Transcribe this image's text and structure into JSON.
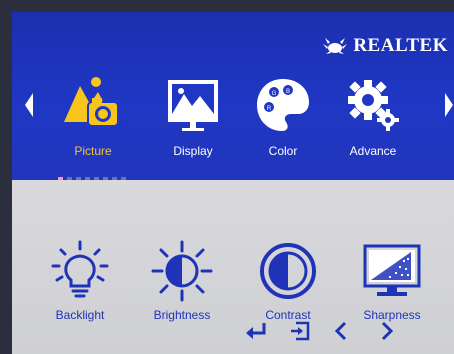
{
  "brand": {
    "name": "REALTEK"
  },
  "colors": {
    "active": "#f7c51c",
    "panel_blue": "#1f37c4",
    "label_blue": "#1f33b8",
    "page_dot": "#ff8fd0"
  },
  "tabs": [
    {
      "label": "Picture",
      "icon": "picture-icon",
      "active": true
    },
    {
      "label": "Display",
      "icon": "display-icon",
      "active": false
    },
    {
      "label": "Color",
      "icon": "color-palette-icon",
      "active": false
    },
    {
      "label": "Advance",
      "icon": "advance-gears-icon",
      "active": false
    }
  ],
  "page_indicator": {
    "count": 8,
    "current": 1
  },
  "items": [
    {
      "label": "Backlight",
      "icon": "lightbulb-icon"
    },
    {
      "label": "Brightness",
      "icon": "sun-icon"
    },
    {
      "label": "Contrast",
      "icon": "contrast-icon"
    },
    {
      "label": "Sharpness",
      "icon": "sharpness-icon"
    }
  ],
  "nav": [
    "enter-icon",
    "exit-icon",
    "left-chevron-icon",
    "right-chevron-icon"
  ]
}
